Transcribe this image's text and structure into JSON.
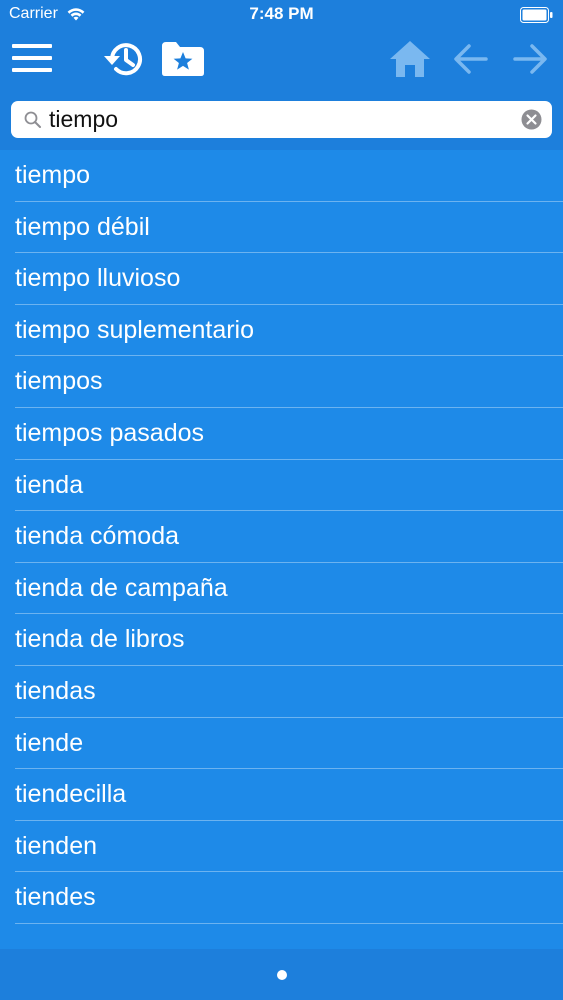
{
  "status_bar": {
    "carrier": "Carrier",
    "time": "7:48 PM"
  },
  "toolbar": {
    "icons": [
      "menu-icon",
      "history-icon",
      "favorites-folder-icon",
      "home-icon",
      "back-arrow-icon",
      "forward-arrow-icon"
    ]
  },
  "search": {
    "value": "tiempo",
    "placeholder": ""
  },
  "results": [
    "tiempo",
    "tiempo débil",
    "tiempo lluvioso",
    "tiempo suplementario",
    "tiempos",
    "tiempos pasados",
    "tienda",
    "tienda cómoda",
    "tienda de campaña",
    "tienda de libros",
    "tiendas",
    "tiende",
    "tiendecilla",
    "tienden",
    "tiendes"
  ],
  "colors": {
    "header": "#1d7fdc",
    "list_background": "#1e8ae8",
    "text": "#ffffff",
    "disabled_icon": "#7ab8f0"
  }
}
